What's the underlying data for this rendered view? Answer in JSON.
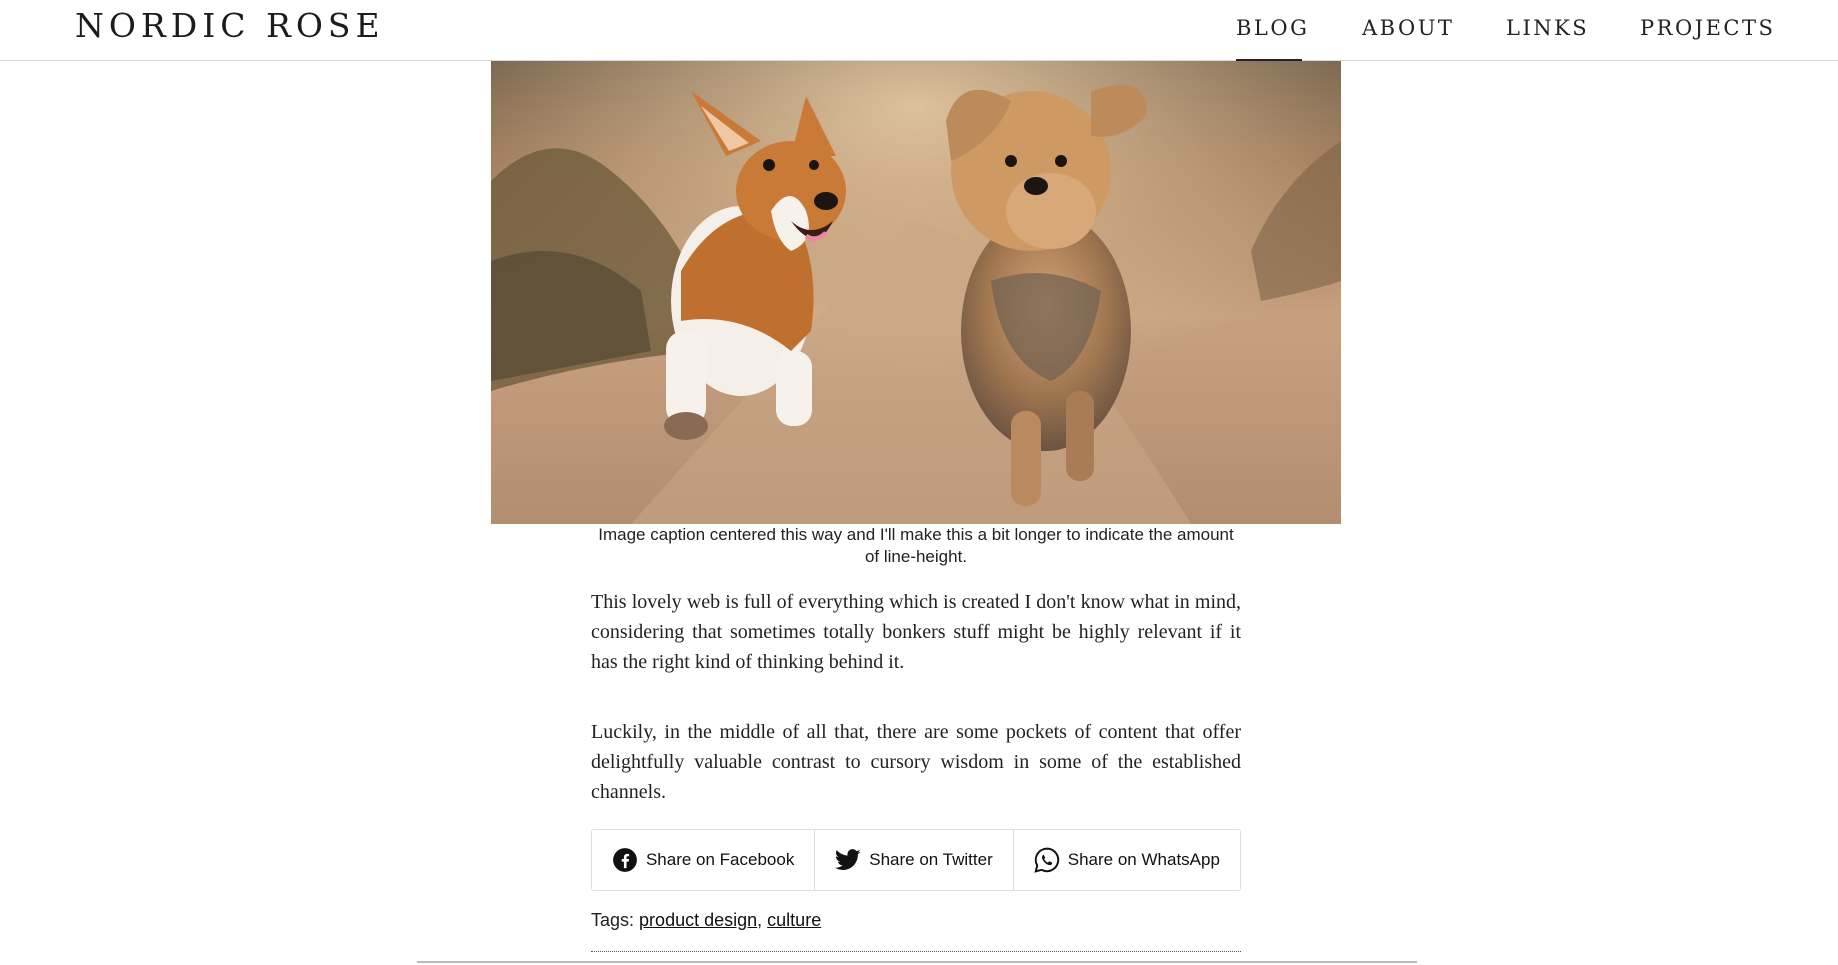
{
  "site": {
    "brand": "NORDIC ROSE"
  },
  "nav": {
    "items": [
      {
        "label": "BLOG"
      },
      {
        "label": "ABOUT"
      },
      {
        "label": "LINKS"
      },
      {
        "label": "PROJECTS"
      }
    ],
    "active": "BLOG"
  },
  "article": {
    "caption": "Image caption centered this way and I'll make this a bit longer to indicate the amount of line-height.",
    "paragraphs": [
      "This lovely web is full of everything which is created I don't know what in mind, considering that sometimes totally bonkers stuff might be highly relevant if it has the right kind of thinking behind it.",
      "Luckily, in the middle of all that, there are some pockets of content that offer delightfully valuable contrast to cursory wisdom in some of the established channels."
    ]
  },
  "share": {
    "facebook": {
      "label": "Share on Facebook",
      "icon": "facebook-icon"
    },
    "twitter": {
      "label": "Share on Twitter",
      "icon": "twitter-icon"
    },
    "whatsapp": {
      "label": "Share on WhatsApp",
      "icon": "whatsapp-icon"
    }
  },
  "tags": {
    "prefix": "Tags:",
    "items": [
      "product design",
      "culture"
    ],
    "separator": ","
  },
  "colors": {
    "text": "#222222",
    "border": "#dddddd"
  }
}
